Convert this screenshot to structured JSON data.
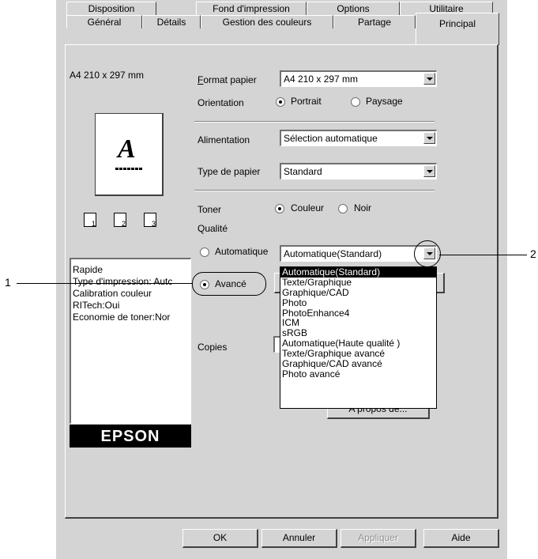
{
  "tabs_back": [
    "Disposition",
    "Fond d'impression",
    "Options",
    "Utilitaire"
  ],
  "tabs_front": [
    "Général",
    "Détails",
    "Gestion des couleurs",
    "Partage",
    "Principal"
  ],
  "preview": {
    "paper_label": "A4 210 x 297 mm",
    "letter": "A",
    "page_nums": [
      "1",
      "2",
      "3"
    ],
    "settings": [
      "Rapide",
      "Type d'impression: Autc",
      "Calibration couleur",
      "RITech:Oui",
      "Economie de toner:Nor"
    ],
    "logo": "EPSON"
  },
  "form": {
    "format_label": "Format papier",
    "format_value": "A4 210 x 297 mm",
    "orientation_label": "Orientation",
    "portrait": "Portrait",
    "paysage": "Paysage",
    "alimentation_label": "Alimentation",
    "alimentation_value": "Sélection automatique",
    "type_label": "Type de papier",
    "type_value": "Standard",
    "toner_label": "Toner",
    "couleur": "Couleur",
    "noir": "Noir",
    "qualite_label": "Qualité",
    "automatique": "Automatique",
    "auto_value": "Automatique(Standard)",
    "avance": "Avancé",
    "copies_label": "Copies",
    "apropos": "A propos de..."
  },
  "dropdown": [
    "Automatique(Standard)",
    "Texte/Graphique",
    "Graphique/CAD",
    "Photo",
    "PhotoEnhance4",
    "ICM",
    "sRGB",
    "Automatique(Haute qualité )",
    "Texte/Graphique avancé",
    "Graphique/CAD avancé",
    "Photo avancé"
  ],
  "buttons": {
    "ok": "OK",
    "annuler": "Annuler",
    "appliquer": "Appliquer",
    "aide": "Aide"
  },
  "callouts": {
    "one": "1",
    "two": "2"
  }
}
